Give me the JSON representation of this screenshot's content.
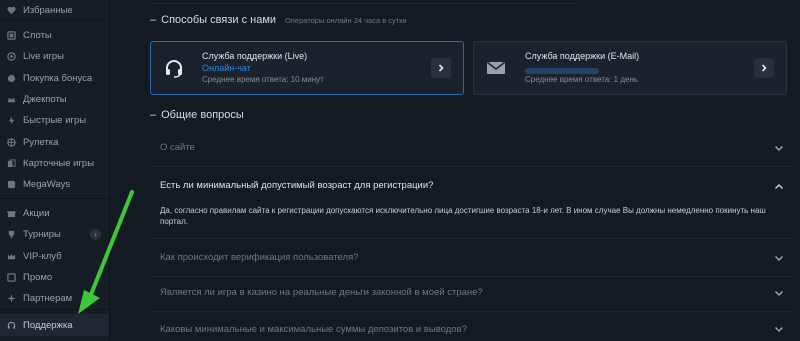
{
  "sidebar": {
    "items": [
      {
        "label": "Избранные",
        "icon": "heart-icon"
      },
      {
        "label": "Слоты",
        "icon": "slots-icon"
      },
      {
        "label": "Live игры",
        "icon": "live-icon"
      },
      {
        "label": "Покупка бонуса",
        "icon": "bonus-icon"
      },
      {
        "label": "Джекпоты",
        "icon": "jackpot-icon"
      },
      {
        "label": "Быстрые игры",
        "icon": "lightning-icon"
      },
      {
        "label": "Рулетка",
        "icon": "roulette-icon"
      },
      {
        "label": "Карточные игры",
        "icon": "cards-icon"
      },
      {
        "label": "MegaWays",
        "icon": "megaways-icon"
      },
      {
        "label": "Акции",
        "icon": "gift-icon"
      },
      {
        "label": "Турниры",
        "icon": "trophy-icon"
      },
      {
        "label": "VIP-клуб",
        "icon": "crown-icon"
      },
      {
        "label": "Промо",
        "icon": "promo-icon"
      },
      {
        "label": "Партнерам",
        "icon": "partners-icon"
      },
      {
        "label": "Поддержка",
        "icon": "headset-icon"
      }
    ]
  },
  "contact": {
    "title": "Способы связи с нами",
    "operators_note": "Операторы онлайн 24 часа в сутки",
    "live": {
      "title": "Служба поддержки (Live)",
      "link": "Онлайн-чат",
      "response": "Среднее время ответа: 10 минут"
    },
    "email": {
      "title": "Служба поддержки (E-Mail)",
      "response": "Среднее время ответа: 1 день"
    }
  },
  "faq": {
    "title": "Общие вопросы",
    "items": [
      {
        "question": "О сайте",
        "open": false
      },
      {
        "question": "Есть ли минимальный допустимый возраст для регистрации?",
        "open": true,
        "answer": "Да, согласно правилам сайта к регистрации допускаются исключительно лица достигшие возраста 18-и лет. В ином случае Вы должны немедленно покинуть наш портал."
      },
      {
        "question": "Как происходит верификация пользователя?",
        "open": false
      },
      {
        "question": "Является ли игра в казино на реальные деньги законной в моей стране?",
        "open": false
      },
      {
        "question": "Каковы минимальные и максимальные суммы депозитов и выводов?",
        "open": false
      }
    ]
  },
  "colors": {
    "accent": "#2f86e2",
    "annotation": "#3cc83a"
  }
}
